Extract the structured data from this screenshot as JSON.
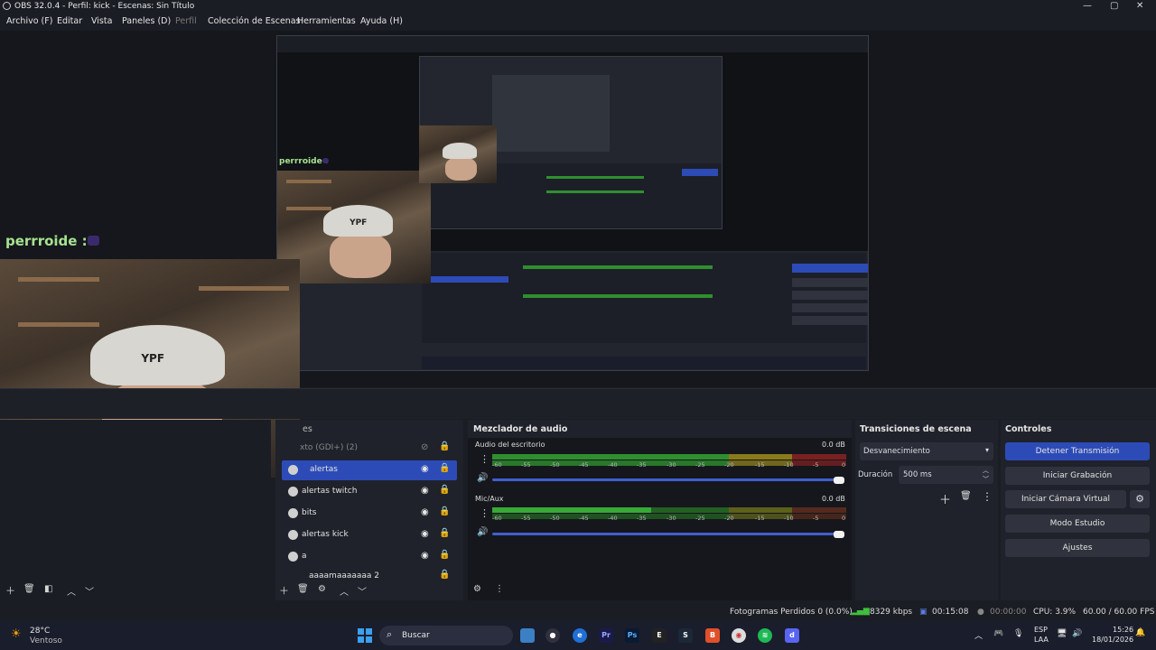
{
  "window": {
    "title": "OBS 32.0.4 - Perfil: kick - Escenas: Sin Título",
    "minimize": "—",
    "maximize": "▢",
    "close": "✕"
  },
  "menu": [
    "Archivo (F)",
    "Editar",
    "Vista",
    "Paneles (D)",
    "Perfil",
    "Colección de Escenas",
    "Herramientas",
    "Ayuda (H)"
  ],
  "preview": {
    "chat_user": "perrroide :",
    "cap_text": "YPF"
  },
  "sources": {
    "header": "es",
    "items": [
      {
        "label": "xto (GDI+) (2)",
        "selected": false,
        "hidden": true
      },
      {
        "label": "alertas",
        "selected": true,
        "hidden": false
      },
      {
        "label": "alertas twitch",
        "selected": false,
        "hidden": false
      },
      {
        "label": "bits",
        "selected": false,
        "hidden": false
      },
      {
        "label": "alertas kick",
        "selected": false,
        "hidden": false
      },
      {
        "label": "a",
        "selected": false,
        "hidden": false
      },
      {
        "label": "aaaamaaaaaaa 2",
        "selected": false,
        "hidden": false
      }
    ]
  },
  "mixer": {
    "title": "Mezclador de audio",
    "tick_labels": [
      "-60",
      "-55",
      "-50",
      "-45",
      "-40",
      "-35",
      "-30",
      "-25",
      "-20",
      "-15",
      "-10",
      "-5",
      "0"
    ],
    "channels": [
      {
        "name": "Audio del escritorio",
        "db": "0.0 dB",
        "level": 0.0
      },
      {
        "name": "Mic/Aux",
        "db": "0.0 dB",
        "level": 0.45
      }
    ]
  },
  "transitions": {
    "title": "Transiciones de escena",
    "type": "Desvanecimiento",
    "duration_label": "Duración",
    "duration_value": "500 ms"
  },
  "controls": {
    "title": "Controles",
    "stop_stream": "Detener Transmisión",
    "start_recording": "Iniciar Grabación",
    "start_virtual_cam": "Iniciar Cámara Virtual",
    "studio_mode": "Modo Estudio",
    "settings": "Ajustes"
  },
  "status": {
    "dropped_frames": "Fotogramas Perdidos 0 (0.0%)",
    "bitrate": "8329 kbps",
    "stream_time": "00:15:08",
    "rec_time": "00:00:00",
    "cpu": "CPU: 3.9%",
    "fps": "60.00 / 60.00 FPS"
  },
  "taskbar": {
    "weather_temp": "28°C",
    "weather_desc": "Ventoso",
    "search": "Buscar",
    "lang": "ESP",
    "lang2": "LAA",
    "time": "15:26",
    "date": "18/01/2026"
  },
  "colors": {
    "accent": "#2d4bb7",
    "meter_green": "#2f8f2f",
    "meter_yellow": "#8a7a1c",
    "meter_red": "#7a2020",
    "chat_name": "#a7e28f"
  }
}
